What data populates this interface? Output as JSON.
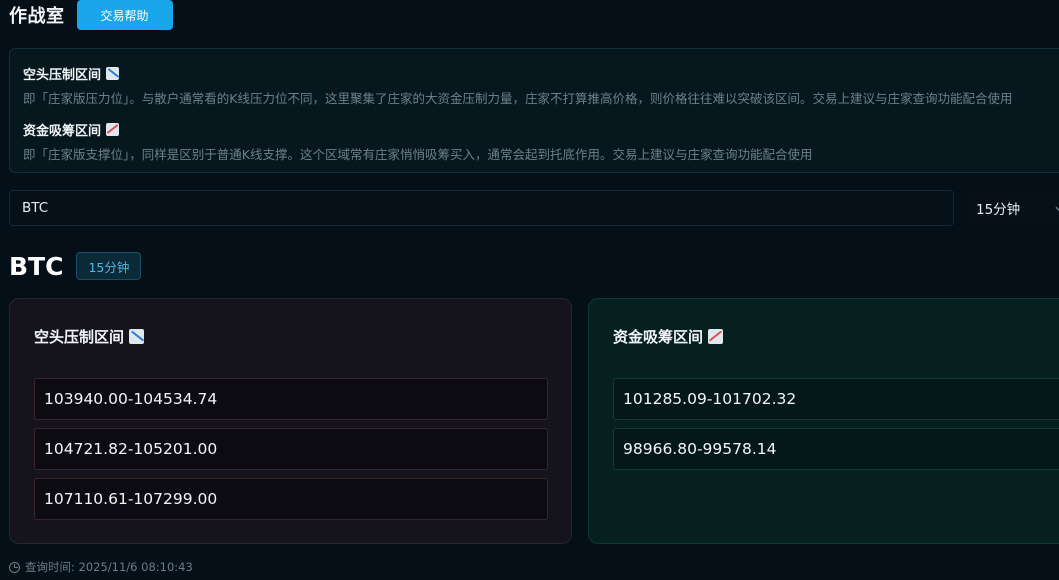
{
  "header": {
    "title": "作战室",
    "help_button": "交易帮助"
  },
  "info": {
    "resist": {
      "title": "空头压制区间",
      "icon": "chart-decreasing-icon",
      "desc": "即「庄家版压力位」。与散户通常看的K线压力位不同，这里聚集了庄家的大资金压制力量，庄家不打算推高价格，则价格往往难以突破该区间。交易上建议与庄家查询功能配合使用"
    },
    "support": {
      "title": "资金吸筹区间",
      "icon": "chart-increasing-icon",
      "desc": "即「庄家版支撑位」，同样是区别于普通K线支撑。这个区域常有庄家悄悄吸筹买入，通常会起到托底作用。交易上建议与庄家查询功能配合使用"
    }
  },
  "search": {
    "value": "BTC"
  },
  "interval_select": {
    "value": "15分钟"
  },
  "result": {
    "symbol": "BTC",
    "interval": "15分钟",
    "resist_panel": {
      "title": "空头压制区间",
      "ranges": [
        "103940.00-104534.74",
        "104721.82-105201.00",
        "107110.61-107299.00"
      ]
    },
    "support_panel": {
      "title": "资金吸筹区间",
      "ranges": [
        "101285.09-101702.32",
        "98966.80-99578.14"
      ]
    }
  },
  "footer": {
    "query_time": "查询时间: 2025/11/6 08:10:43"
  },
  "colors": {
    "accent": "#1aa6ea",
    "resist_panel_bg": "#15141d",
    "support_panel_bg": "#06201f"
  }
}
